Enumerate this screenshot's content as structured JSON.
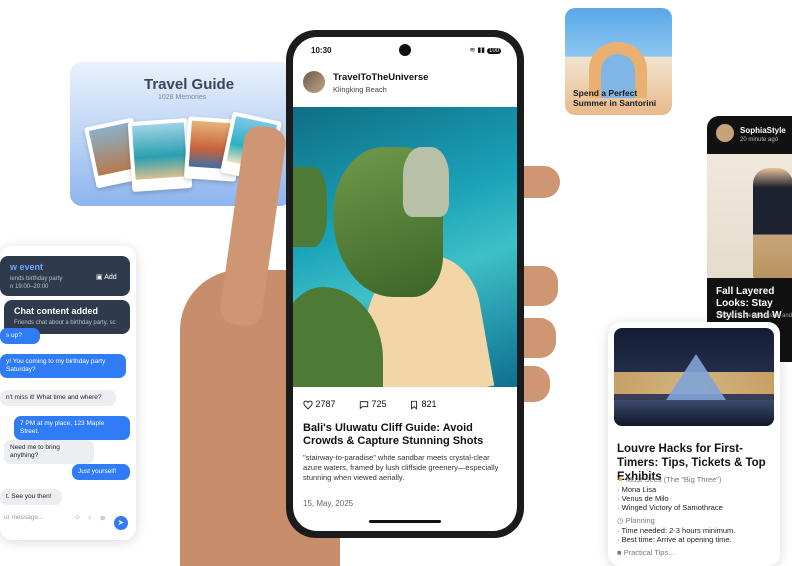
{
  "travel_card": {
    "title": "Travel Guide",
    "subtitle": "1028 Memories"
  },
  "santorini_card": {
    "caption": "Spend a Perfect Summer in Santorini"
  },
  "fashion_card": {
    "username": "SophiaStyle",
    "time": "20 minute ago",
    "title": "Fall Layered Looks: Stay Stylish and W",
    "description": "This outfit blends casual and"
  },
  "louvre_card": {
    "title": "Louvre Hacks for First-Timers: Tips, Tickets & Top Exhibits",
    "must_sees_heading": "Must-Sees (The \"Big Three\")",
    "must_sees": [
      "· Mona Lisa",
      "· Venus de Milo",
      "· Winged Victory of Samothrace"
    ],
    "planning_heading": "Planning",
    "planning": [
      "· Time needed: 2-3 hours minimum.",
      "· Best time: Arrive at opening time."
    ],
    "practical_heading": "Practical Tips..."
  },
  "chat_card": {
    "notice_event_title": "w event",
    "notice_event_sub1": "iends birthday party",
    "notice_event_sub2": "n 19:00–20:00",
    "notice_event_add": "Add",
    "notice_chat_title": "Chat content added",
    "notice_chat_sub": "Friends chat about a birthday party, sc",
    "messages": [
      {
        "from": "me",
        "text": "s up?"
      },
      {
        "from": "me",
        "text": "y! You coming to my birthday party Saturday?"
      },
      {
        "from": "them",
        "text": "n't miss it! What time and where?"
      },
      {
        "from": "me",
        "text": "7 PM at my place, 123 Maple Street."
      },
      {
        "from": "them",
        "text": "Need me to bring anything?"
      },
      {
        "from": "me",
        "text": "Just yourself!"
      },
      {
        "from": "them",
        "text": "t. See you then!"
      }
    ],
    "input_placeholder": "ur message..."
  },
  "phone": {
    "status_time": "10:30",
    "status_right": "100",
    "username": "TravelToTheUniverse",
    "location": "Klingking Beach",
    "likes": "2787",
    "comments": "725",
    "saves": "821",
    "title": "Bali's Uluwatu Cliff Guide: Avoid Crowds & Capture Stunning Shots",
    "description": "\"stairway-to-paradise\" white sandbar meets crystal-clear azure waters, framed by lush cliffside greenery—especially stunning when viewed aerially.",
    "date": "15, May, 2025"
  }
}
